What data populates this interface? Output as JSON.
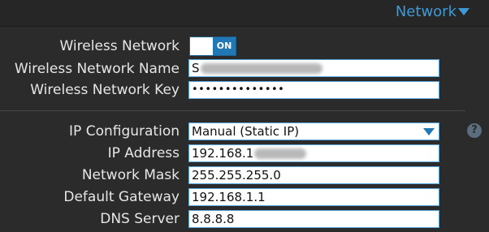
{
  "header": {
    "section_label": "Network"
  },
  "wireless": {
    "enabled_label": "Wireless Network",
    "toggle_state": "ON",
    "name_label": "Wireless Network Name",
    "name_value_visible": "S",
    "key_label": "Wireless Network Key",
    "key_value_masked": "••••••••••••••"
  },
  "ip": {
    "config_label": "IP Configuration",
    "config_selected": "Manual (Static IP)",
    "address_label": "IP Address",
    "address_value_visible": "192.168.1",
    "mask_label": "Network Mask",
    "mask_value": "255.255.255.0",
    "gateway_label": "Default Gateway",
    "gateway_value": "192.168.1.1",
    "dns_label": "DNS Server",
    "dns_value": "8.8.8.8",
    "help_glyph": "?"
  },
  "colors": {
    "accent": "#3d9ad8",
    "toggle_on": "#2277b5",
    "background": "#2b2b2b",
    "field_border": "#5aa8dc"
  },
  "icons": {
    "header_dropdown": "chevron-down-icon",
    "select_dropdown": "chevron-down-icon",
    "help": "help-icon"
  }
}
